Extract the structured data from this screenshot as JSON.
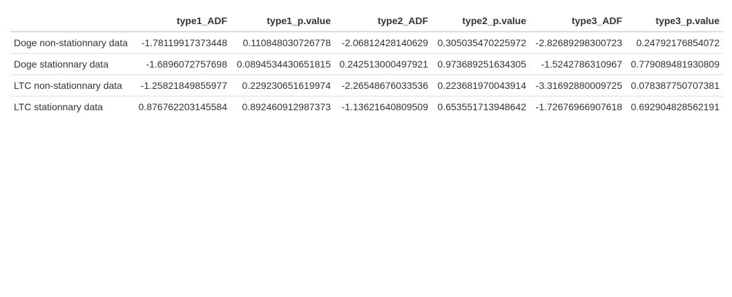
{
  "table": {
    "columns": [
      "",
      "type1_ADF",
      "type1_p.value",
      "type2_ADF",
      "type2_p.value",
      "type3_ADF",
      "type3_p.value"
    ],
    "rows": [
      [
        "Doge non-stationnary data",
        "-1.78119917373448",
        "0.110848030726778",
        "-2.06812428140629",
        "0.305035470225972",
        "-2.82689298300723",
        "0.24792176854072"
      ],
      [
        "Doge stationnary data",
        "-1.6896072757698",
        "0.0894534430651815",
        "0.242513000497921",
        "0.973689251634305",
        "-1.5242786310967",
        "0.779089481930809"
      ],
      [
        "LTC non-stationnary data",
        "-1.25821849855977",
        "0.229230651619974",
        "-2.26548676033536",
        "0.223681970043914",
        "-3.31692880009725",
        "0.078387750707381"
      ],
      [
        "LTC stationnary data",
        "0.876762203145584",
        "0.892460912987373",
        "-1.13621640809509",
        "0.653551713948642",
        "-1.72676966907618",
        "0.692904828562191"
      ]
    ]
  },
  "colors": {
    "text": "#333333",
    "border": "#dddddd",
    "background": "#ffffff"
  }
}
